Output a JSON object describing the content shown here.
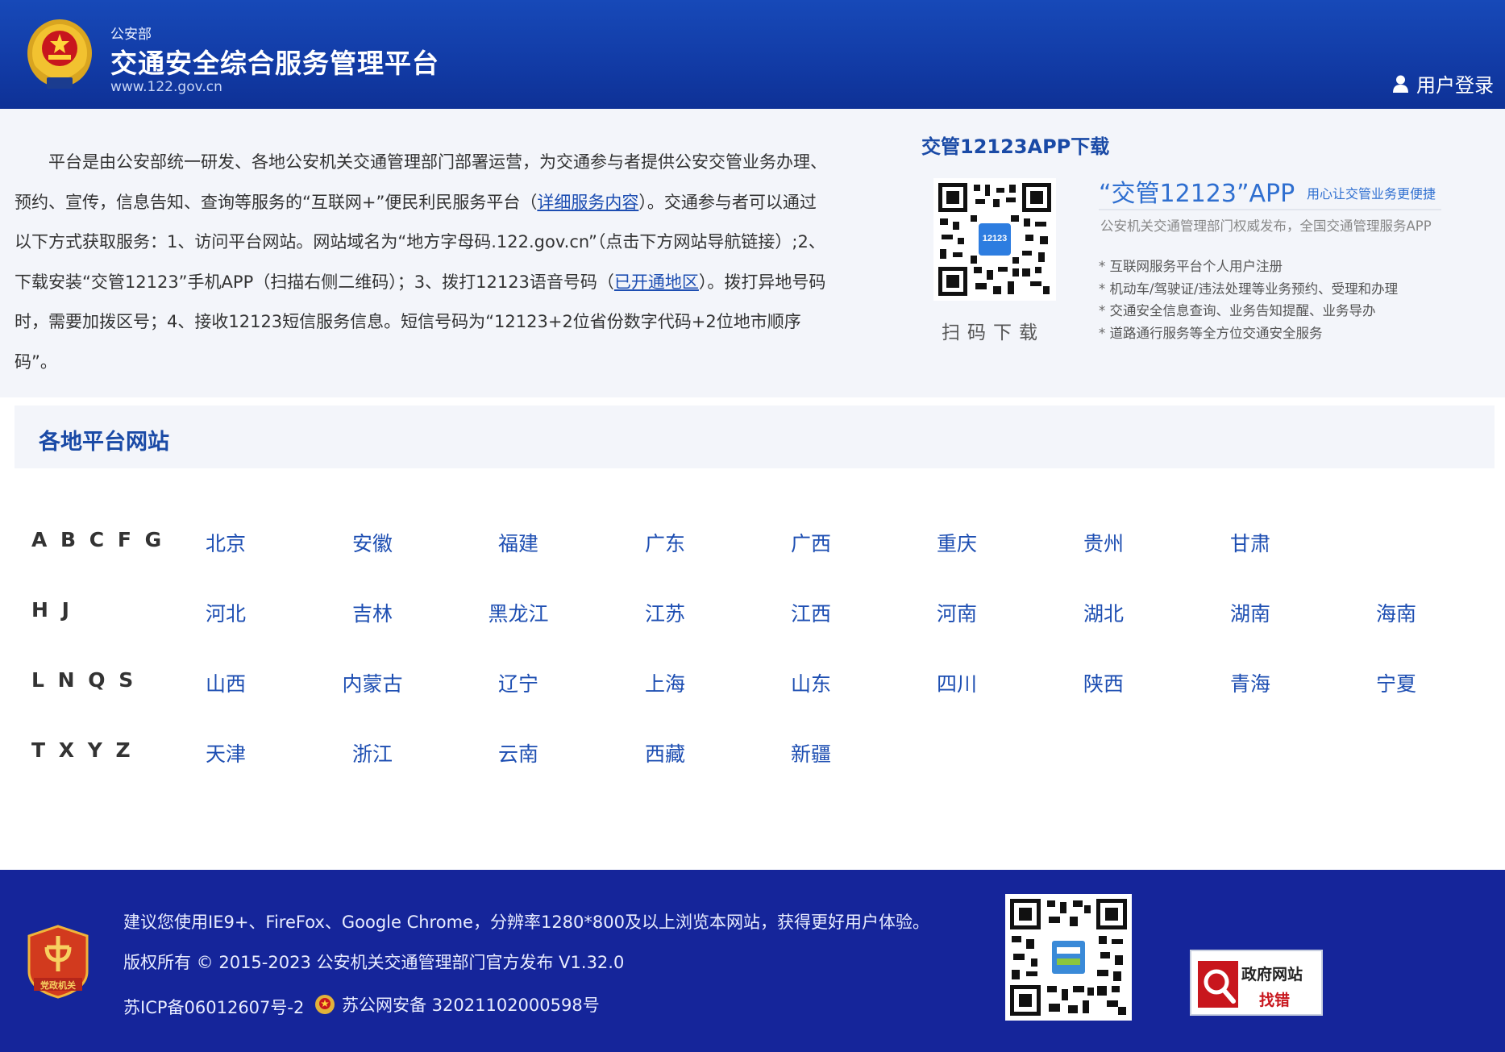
{
  "header": {
    "org": "公安部",
    "title": "交通安全综合服务管理平台",
    "url": "www.122.gov.cn",
    "login_label": "用户登录"
  },
  "intro": {
    "text_1": "平台是由公安部统一研发、各地公安机关交通管理部门部署运营，为交通参与者提供公安交管业务办理、预约、宣传，信息告知、查询等服务的“互联网+”便民利民服务平台（",
    "link_1": "详细服务内容",
    "text_2": "）。交通参与者可以通过以下方式获取服务：1、访问平台网站。网站域名为“地方字母码.122.gov.cn”（点击下方网站导航链接）;2、下载安装“交管12123”手机APP（扫描右侧二维码）；3、拨打12123语音号码（",
    "link_2": "已开通地区",
    "text_3": "）。拨打异地号码时，需要加拨区号；4、接收12123短信服务信息。短信号码为“12123+2位省份数字代码+2位地市顺序码”。"
  },
  "app": {
    "download_title": "交管12123APP下载",
    "scan_label": "扫码下载",
    "name": "“交管12123”APP",
    "slogan": "用心让交管业务更便捷",
    "subtitle": "公安机关交通管理部门权威发布，全国交通管理服务APP",
    "features": [
      "互联网服务平台个人用户注册",
      "机动车/驾驶证/违法处理等业务预约、受理和办理",
      "交通安全信息查询、业务告知提醒、业务导办",
      "道路通行服务等全方位交通安全服务"
    ],
    "qr_badge": "12123"
  },
  "section": {
    "title": "各地平台网站"
  },
  "regions": [
    {
      "letters": "A B C F G",
      "items": [
        "北京",
        "安徽",
        "福建",
        "广东",
        "广西",
        "重庆",
        "贵州",
        "甘肃"
      ]
    },
    {
      "letters": "H J",
      "items": [
        "河北",
        "吉林",
        "黑龙江",
        "江苏",
        "江西",
        "河南",
        "湖北",
        "湖南",
        "海南"
      ]
    },
    {
      "letters": "L N Q S",
      "items": [
        "山西",
        "内蒙古",
        "辽宁",
        "上海",
        "山东",
        "四川",
        "陕西",
        "青海",
        "宁夏"
      ]
    },
    {
      "letters": "T X Y Z",
      "items": [
        "天津",
        "浙江",
        "云南",
        "西藏",
        "新疆"
      ]
    }
  ],
  "footer": {
    "browser_tip": "建议您使用IE9+、FireFox、Google Chrome，分辨率1280*800及以上浏览本网站，获得更好用户体验。",
    "copyright": "版权所有 © 2015-2023 公安机关交通管理部门官方发布 V1.32.0",
    "icp": "苏ICP备06012607号-2",
    "police_record": "苏公网安备 32021102000598号",
    "party_badge_text": "党政机关",
    "gov_btn_line1": "政府网站",
    "gov_btn_line2": "找错"
  },
  "colors": {
    "header_blue": "#123ca7",
    "link_blue": "#1d4eb2",
    "section_title": "#1a4aa6",
    "footer_blue": "#15259a",
    "gov_red": "#c8161d"
  }
}
